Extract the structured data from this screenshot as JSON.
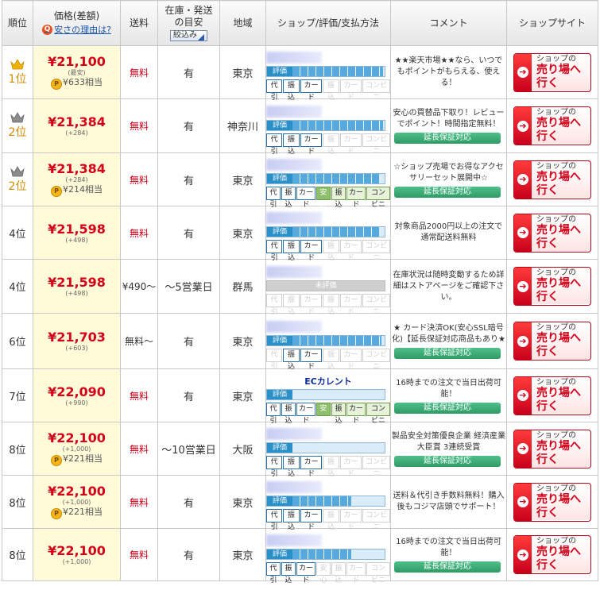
{
  "header": {
    "rank": "順位",
    "price": "価格(差額)",
    "why_cheap": "安さの理由は?",
    "shipping": "送料",
    "stock_line1": "在庫・発送",
    "stock_line2": "の目安",
    "filter_button": "絞込み",
    "area": "地域",
    "shop": "ショップ/評価/支払方法",
    "comment": "コメント",
    "site": "ショップサイト"
  },
  "labels": {
    "eval": "評価",
    "unrated": "未評価",
    "warranty": "延長保証対応",
    "shop_btn_line1": "ショップの",
    "shop_btn_line2": "売り場へ行く"
  },
  "pay_labels": {
    "daibiki": "代引",
    "furikomi": "振込",
    "card": "カード",
    "anshin": "安心",
    "furikomi2": "振込",
    "card2": "カード",
    "conv": "コンビニ"
  },
  "rows": [
    {
      "rank": "1位",
      "crown": "gold",
      "price": "¥21,100",
      "diff": "(最安)",
      "points": "¥633相当",
      "shipping": "無料",
      "stock": "有",
      "area": "東京",
      "shop_text": "",
      "eval_pct": 92,
      "unrated": false,
      "pay": {
        "daibiki": "on",
        "furikomi": "on",
        "card": "on",
        "anshin": "none",
        "furikomi2": "off",
        "card2": "off",
        "conv": "off"
      },
      "comment": "★★楽天市場★★なら、いつでもポイントがもらえる、使える！",
      "warranty": false
    },
    {
      "rank": "2位",
      "crown": "silver",
      "price": "¥21,384",
      "diff": "(+284)",
      "points": "",
      "shipping": "無料",
      "stock": "有",
      "area": "神奈川",
      "shop_text": "",
      "eval_pct": 92,
      "unrated": false,
      "pay": {
        "daibiki": "on",
        "furikomi": "on",
        "card": "on",
        "anshin": "none",
        "furikomi2": "off",
        "card2": "off",
        "conv": "off"
      },
      "comment": "安心の買替品下取り！レビューでポイント！時間指定無料！",
      "warranty": true
    },
    {
      "rank": "2位",
      "crown": "silver",
      "price": "¥21,384",
      "diff": "(+284)",
      "points": "¥214相当",
      "shipping": "無料",
      "stock": "有",
      "area": "東京",
      "shop_text": "",
      "eval_pct": 88,
      "unrated": false,
      "pay": {
        "daibiki": "on",
        "furikomi": "on",
        "card": "on",
        "anshin": "on",
        "furikomi2": "on",
        "card2": "on",
        "conv": "on"
      },
      "comment": "☆ショップ売場でお得なアクセサリーセット展開中☆",
      "warranty": true
    },
    {
      "rank": "4位",
      "crown": "",
      "price": "¥21,598",
      "diff": "(+498)",
      "points": "",
      "shipping": "無料",
      "stock": "有",
      "area": "東京",
      "shop_text": "",
      "eval_pct": 88,
      "unrated": false,
      "pay": {
        "daibiki": "on",
        "furikomi": "on",
        "card": "on",
        "anshin": "none",
        "furikomi2": "off",
        "card2": "off",
        "conv": "off"
      },
      "comment": "対象商品2000円以上の注文で通常配送料無料",
      "warranty": false
    },
    {
      "rank": "4位",
      "crown": "",
      "price": "¥21,598",
      "diff": "(+498)",
      "points": "",
      "shipping": "¥490〜",
      "stock": "〜5営業日",
      "area": "群馬",
      "shop_text": "",
      "eval_pct": 0,
      "unrated": true,
      "pay": {
        "daibiki": "off",
        "furikomi": "off",
        "card": "off",
        "anshin": "none",
        "furikomi2": "off",
        "card2": "off",
        "conv": "off"
      },
      "comment": "在庫状況は随時変動するため詳細はストアページをご確認下さい。",
      "warranty": false
    },
    {
      "rank": "6位",
      "crown": "",
      "price": "¥21,703",
      "diff": "(+603)",
      "points": "",
      "shipping": "無料〜",
      "stock": "有",
      "area": "東京",
      "shop_text": "",
      "eval_pct": 90,
      "unrated": false,
      "pay": {
        "daibiki": "off",
        "furikomi": "on",
        "card": "on",
        "anshin": "none",
        "furikomi2": "off",
        "card2": "off",
        "conv": "off"
      },
      "comment": "★ カード決済OK(安心SSL暗号化)【延長保証対応商品もあり★",
      "warranty": true
    },
    {
      "rank": "7位",
      "crown": "",
      "price": "¥22,090",
      "diff": "(+990)",
      "points": "",
      "shipping": "無料",
      "stock": "有",
      "area": "東京",
      "shop_text": "ECカレント",
      "eval_pct": 0,
      "unrated": false,
      "pay": {
        "daibiki": "on",
        "furikomi": "on",
        "card": "on",
        "anshin": "on",
        "furikomi2": "on",
        "card2": "on",
        "conv": "on"
      },
      "comment": "16時までの注文で当日出荷可能！",
      "warranty": true
    },
    {
      "rank": "8位",
      "crown": "",
      "price": "¥22,100",
      "diff": "(+1,000)",
      "points": "¥221相当",
      "shipping": "無料",
      "stock": "〜10営業日",
      "area": "大阪",
      "shop_text": "",
      "eval_pct": 0,
      "unrated": false,
      "pay": {
        "daibiki": "on",
        "furikomi": "on",
        "card": "on",
        "anshin": "none",
        "furikomi2": "off",
        "card2": "off",
        "conv": "off"
      },
      "comment": "製品安全対策優良企業 経済産業大臣賞 3連続受賞",
      "warranty": true
    },
    {
      "rank": "8位",
      "crown": "",
      "price": "¥22,100",
      "diff": "(+1,000)",
      "points": "¥221相当",
      "shipping": "無料",
      "stock": "有",
      "area": "東京",
      "shop_text": "",
      "eval_pct": 60,
      "unrated": false,
      "pay": {
        "daibiki": "on",
        "furikomi": "on",
        "card": "on",
        "anshin": "none",
        "furikomi2": "off",
        "card2": "off",
        "conv": "off"
      },
      "comment": "送料＆代引き手数料無料！購入後もコジマ店頭でサポート！",
      "warranty": false
    },
    {
      "rank": "8位",
      "crown": "",
      "price": "¥22,100",
      "diff": "(+1,000)",
      "points": "",
      "shipping": "無料",
      "stock": "有",
      "area": "東京",
      "shop_text": "",
      "eval_pct": 60,
      "unrated": false,
      "pay": {
        "daibiki": "on",
        "furikomi": "on",
        "card": "on",
        "anshin": "off",
        "furikomi2": "off",
        "card2": "off",
        "conv": "off"
      },
      "comment": "16時までの注文で当日出荷可能！",
      "warranty": true
    }
  ]
}
